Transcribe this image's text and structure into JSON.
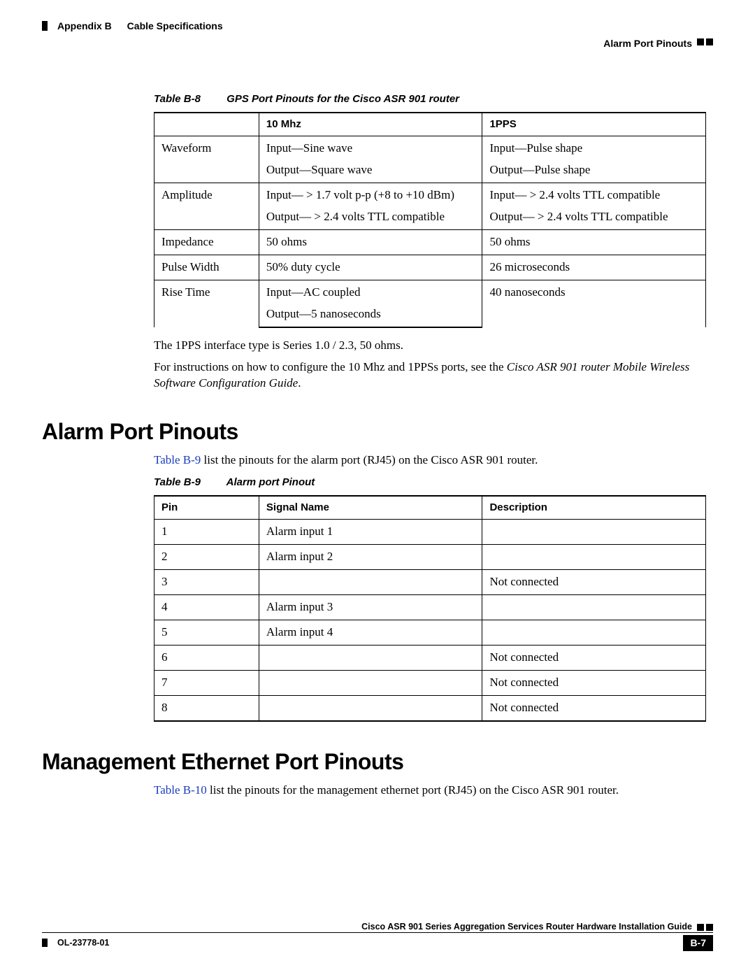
{
  "header": {
    "appendix": "Appendix B",
    "title": "Cable Specifications",
    "section_running": "Alarm Port Pinouts"
  },
  "table_b8": {
    "caption_num": "Table B-8",
    "caption_title": "GPS Port Pinouts for the Cisco ASR 901 router",
    "headers": {
      "c1": "",
      "c2": "10 Mhz",
      "c3": "1PPS"
    },
    "rows": [
      {
        "key": "Waveform",
        "c2a": "Input—Sine wave",
        "c2b": "Output—Square wave",
        "c3a": "Input—Pulse shape",
        "c3b": "Output—Pulse shape"
      },
      {
        "key": "Amplitude",
        "c2a": "Input— > 1.7 volt p-p (+8 to +10 dBm)",
        "c2b": "Output— > 2.4 volts TTL compatible",
        "c3a": "Input— > 2.4 volts TTL compatible",
        "c3b": "Output— > 2.4 volts TTL compatible"
      },
      {
        "key": "Impedance",
        "c2": "50 ohms",
        "c3": "50 ohms"
      },
      {
        "key": "Pulse Width",
        "c2": "50% duty cycle",
        "c3": "26 microseconds"
      },
      {
        "key": "Rise Time",
        "c2a": "Input—AC coupled",
        "c2b": "Output—5 nanoseconds",
        "c3": "40 nanoseconds"
      }
    ],
    "after_p1": "The 1PPS interface type is Series 1.0 / 2.3, 50 ohms.",
    "after_p2a": "For instructions on how to configure the 10 Mhz and 1PPSs ports, see the ",
    "after_p2_ital": "Cisco ASR 901 router Mobile Wireless Software Configuration Guide",
    "after_p2b": "."
  },
  "section_alarm": {
    "heading": "Alarm Port Pinouts",
    "intro_link": "Table B-9",
    "intro_rest": " list the pinouts for the alarm port (RJ45) on the Cisco ASR 901 router."
  },
  "table_b9": {
    "caption_num": "Table B-9",
    "caption_title": "Alarm port Pinout",
    "headers": {
      "c1": "Pin",
      "c2": "Signal Name",
      "c3": "Description"
    },
    "rows": [
      {
        "pin": "1",
        "signal": "Alarm input 1",
        "desc": ""
      },
      {
        "pin": "2",
        "signal": "Alarm input 2",
        "desc": ""
      },
      {
        "pin": "3",
        "signal": "",
        "desc": "Not connected"
      },
      {
        "pin": "4",
        "signal": "Alarm input 3",
        "desc": ""
      },
      {
        "pin": "5",
        "signal": "Alarm input 4",
        "desc": ""
      },
      {
        "pin": "6",
        "signal": "",
        "desc": "Not connected"
      },
      {
        "pin": "7",
        "signal": "",
        "desc": "Not connected"
      },
      {
        "pin": "8",
        "signal": "",
        "desc": "Not connected"
      }
    ]
  },
  "section_mgmt": {
    "heading": "Management Ethernet Port Pinouts",
    "intro_link": "Table B-10",
    "intro_rest": " list the pinouts for the management ethernet port (RJ45) on the Cisco ASR 901 router."
  },
  "footer": {
    "book_title": "Cisco ASR 901 Series Aggregation Services Router Hardware Installation Guide",
    "doc_id": "OL-23778-01",
    "page": "B-7"
  }
}
